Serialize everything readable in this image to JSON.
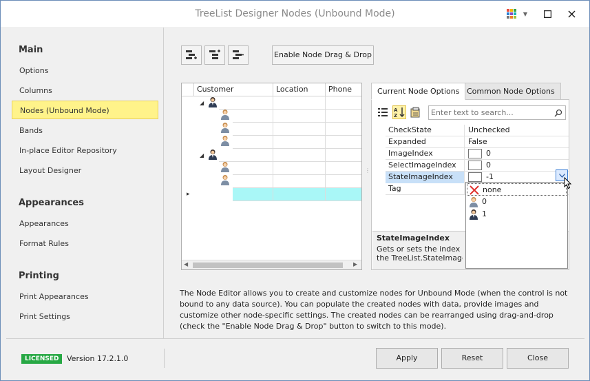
{
  "window": {
    "title": "TreeList Designer Nodes (Unbound Mode)"
  },
  "nav": {
    "sections": [
      {
        "heading": "Main",
        "items": [
          "Options",
          "Columns",
          "Nodes (Unbound Mode)",
          "Bands",
          "In-place Editor Repository",
          "Layout Designer"
        ]
      },
      {
        "heading": "Appearances",
        "items": [
          "Appearances",
          "Format Rules"
        ]
      },
      {
        "heading": "Printing",
        "items": [
          "Print Appearances",
          "Print Settings"
        ]
      }
    ],
    "active_item": "Nodes (Unbound Mode)"
  },
  "toolbar": {
    "drag_drop_label": "Enable Node Drag & Drop"
  },
  "tree": {
    "columns": [
      "Customer",
      "Location",
      "Phone"
    ]
  },
  "tabs": [
    "Current Node Options",
    "Common Node Options"
  ],
  "search": {
    "placeholder": "Enter text to search..."
  },
  "properties": [
    {
      "name": "CheckState",
      "value": "Unchecked"
    },
    {
      "name": "Expanded",
      "value": "False"
    },
    {
      "name": "ImageIndex",
      "value": "0"
    },
    {
      "name": "SelectImageIndex",
      "value": "0"
    },
    {
      "name": "StateImageIndex",
      "value": "-1"
    },
    {
      "name": "Tag",
      "value": ""
    }
  ],
  "dropdown": {
    "items": [
      "none",
      "0",
      "1"
    ]
  },
  "description": {
    "title": "StateImageIndex",
    "text_line1": "Gets or sets the index of th",
    "text_line2": "the TreeList.StateImageLis"
  },
  "info": "The Node Editor allows you to create and customize nodes for Unbound Mode (when the control is not bound to any data source). You can populate the created nodes with data, provide images and customize other node-specific settings. The created nodes can be rearranged using drag-and-drop (check the \"Enable Node Drag & Drop\" button to switch to this mode).",
  "footer": {
    "license_badge": "LICENSED",
    "version": "Version 17.2.1.0",
    "apply_label": "Apply",
    "reset_label": "Reset",
    "close_label": "Close"
  }
}
